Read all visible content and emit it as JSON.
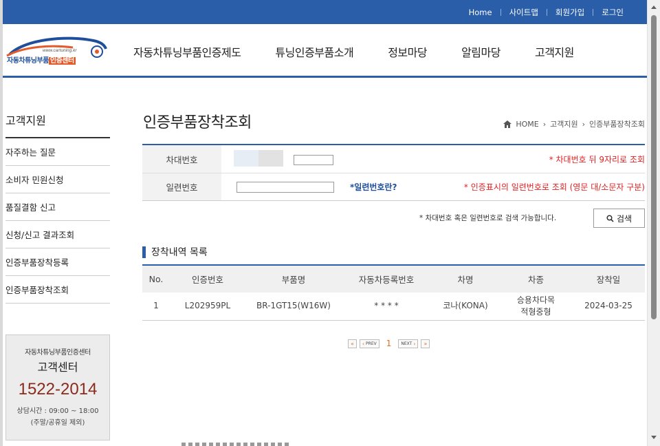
{
  "top_links": [
    "Home",
    "사이트맵",
    "회원가입",
    "로그인"
  ],
  "logo": {
    "url": "www.cartuning.kr",
    "name_prefix": "자동차튜닝부품",
    "name_highlight": "인증센터"
  },
  "gnb": [
    "자동차튜닝부품인증제도",
    "튜닝인증부품소개",
    "정보마당",
    "알림마당",
    "고객지원"
  ],
  "sidebar": {
    "title": "고객지원",
    "items": [
      {
        "label": "자주하는 질문"
      },
      {
        "label": "소비자 민원신청"
      },
      {
        "label": "품질결함 신고"
      },
      {
        "label": "신청/신고 결과조회"
      },
      {
        "label": "인증부품장착등록"
      },
      {
        "label": "인증부품장착조회"
      }
    ]
  },
  "customer_center": {
    "org": "자동차튜닝부품인증센터",
    "title": "고객센터",
    "phone": "1522-2014",
    "hours": "상담시간 : 09:00 ~ 18:00",
    "hours_note": "(주말/공휴일 제외)"
  },
  "page": {
    "title": "인증부품장착조회",
    "breadcrumb": [
      "HOME",
      "고객지원",
      "인증부품장착조회"
    ]
  },
  "search": {
    "plate_label": "차대번호",
    "plate_note": "* 차대번호 뒤 9자리로 조회",
    "serial_label": "일련번호",
    "serial_link": "*일련번호란?",
    "serial_note": "* 인증표시의 일련번호로 조회 (영문 대/소문자 구분)",
    "help": "* 차대번호 혹은 일련번호로 검색 가능합니다.",
    "button": "검색"
  },
  "list": {
    "title": "장착내역 목록",
    "columns": [
      "No.",
      "인증번호",
      "부품명",
      "자동차등록번호",
      "차명",
      "차종",
      "장착일"
    ],
    "rows": [
      {
        "no": "1",
        "cert": "L202959PL",
        "part": "BR-1GT15(W16W)",
        "reg": "* * * *",
        "car": "코나(KONA)",
        "type_line1": "승용차다목",
        "type_line2": "적형중형",
        "date": "2024-03-25"
      }
    ]
  },
  "pager": {
    "prev": "PREV",
    "current": "1",
    "next": "NEXT"
  },
  "colors": {
    "primary": "#2a5ea8",
    "alert": "#e32020",
    "phone": "#8a2b1c",
    "pager_accent": "#e07020"
  }
}
